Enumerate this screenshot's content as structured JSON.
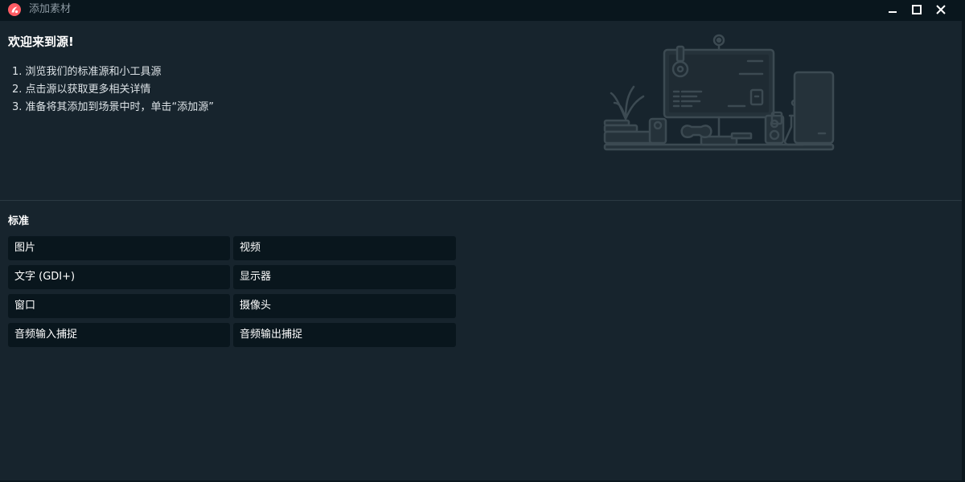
{
  "window": {
    "title": "添加素材",
    "controls": [
      "minimize-icon",
      "maximize-icon",
      "close-icon"
    ]
  },
  "welcome": {
    "title": "欢迎来到源!",
    "steps": [
      "1. 浏览我们的标准源和小工具源",
      "2. 点击源以获取更多相关详情",
      "3. 准备将其添加到场景中时，单击“添加源”"
    ]
  },
  "standard": {
    "title": "标准",
    "sources": [
      {
        "label": "图片"
      },
      {
        "label": "视频"
      },
      {
        "label": "文字 (GDI+)"
      },
      {
        "label": "显示器"
      },
      {
        "label": "窗口"
      },
      {
        "label": "摄像头"
      },
      {
        "label": "音频输入捕捉"
      },
      {
        "label": "音频输出捕捉"
      }
    ]
  },
  "colors": {
    "background": "#17242d",
    "titlebar": "#09161d",
    "button": "#09161d",
    "accent": "#ff5b63",
    "illustration": "#3c4a52"
  }
}
